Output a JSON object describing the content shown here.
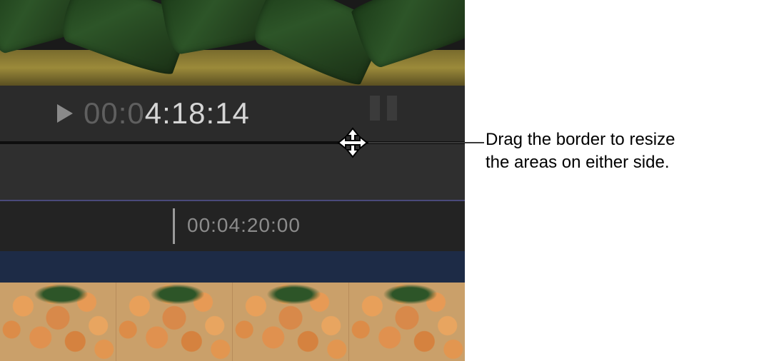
{
  "viewer": {
    "timecode_dim": "00:0",
    "timecode_lit": "4:18:14"
  },
  "timeline": {
    "ruler_timecode": "00:04:20:00"
  },
  "callout": {
    "line1": "Drag the border to resize",
    "line2": "the areas on either side."
  }
}
